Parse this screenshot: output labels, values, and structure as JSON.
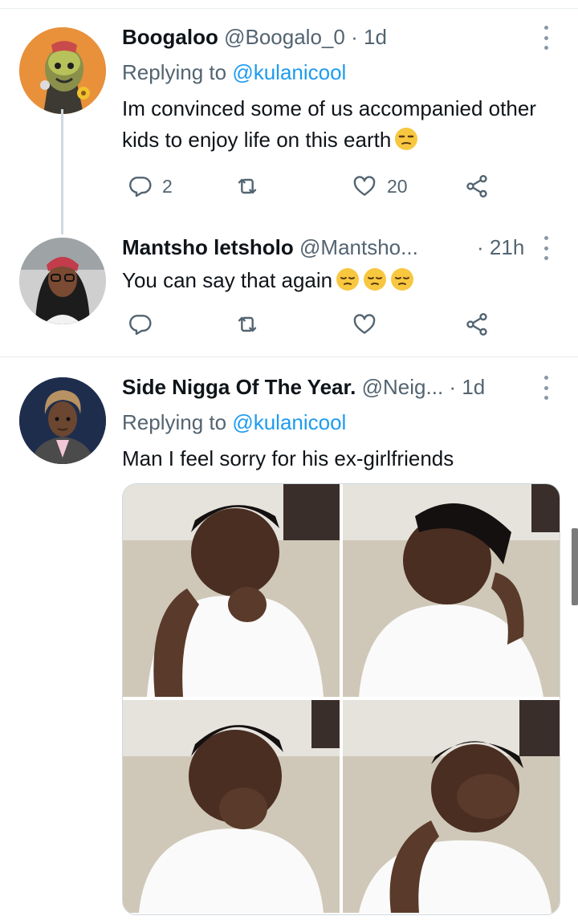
{
  "tweets": [
    {
      "name": "Boogaloo",
      "handle": "@Boogalo_0",
      "dot": "·",
      "time": "1d",
      "replying_prefix": "Replying to",
      "replying_to": "@kulanicool",
      "text": "Im convinced some of us accompanied other kids to enjoy life on this earth",
      "emoji": "unamused-face",
      "replies": "2",
      "retweets": "",
      "likes": "20"
    },
    {
      "name": "Mantsho letsholo",
      "handle": "@Mantsho...",
      "dot": "·",
      "time": "21h",
      "text": "You can say that again",
      "emoji": "pensive-face x3",
      "replies": "",
      "retweets": "",
      "likes": ""
    },
    {
      "name": "Side Nigga Of The Year.",
      "handle": "@Neig...",
      "dot": "·",
      "time": "1d",
      "replying_prefix": "Replying to",
      "replying_to": "@kulanicool",
      "text": "Man I feel sorry for his ex-girlfriends",
      "media": "4-photo grid"
    }
  ],
  "icons": [
    "reply-icon",
    "retweet-icon",
    "like-icon",
    "share-icon",
    "more-icon"
  ],
  "colors": {
    "link": "#1d9bf0",
    "secondary": "#536471",
    "text": "#0f1419",
    "icon": "#536471"
  }
}
